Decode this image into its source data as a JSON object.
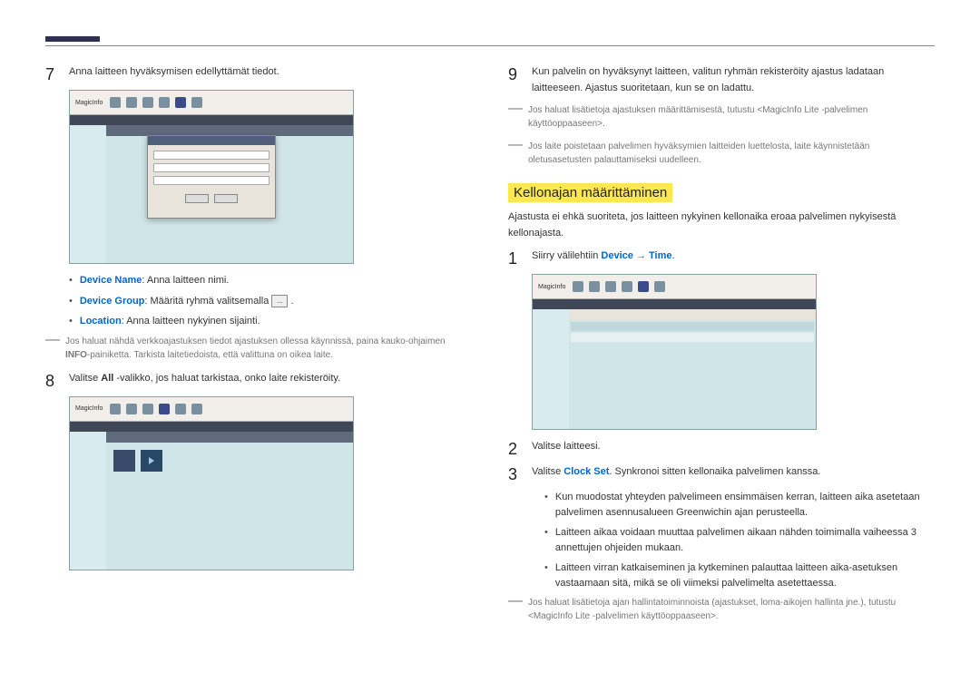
{
  "left": {
    "step7": {
      "num": "7",
      "text": "Anna laitteen hyväksymisen edellyttämät tiedot."
    },
    "ss1_logo": "MagicInfo",
    "bullets": {
      "deviceName_label": "Device Name",
      "deviceName_text": ": Anna laitteen nimi.",
      "deviceGroup_label": "Device Group",
      "deviceGroup_text": ": Määritä ryhmä valitsemalla",
      "deviceGroup_after": ".",
      "dots": "...",
      "location_label": "Location",
      "location_text": ": Anna laitteen nykyinen sijainti."
    },
    "note1": "Jos haluat nähdä verkkoajastuksen tiedot ajastuksen ollessa käynnissä, paina kauko-ohjaimen ",
    "note1_bold": "INFO",
    "note1_after": "-painiketta. Tarkista laitetiedoista, että valittuna on oikea laite.",
    "step8": {
      "num": "8",
      "text_before": "Valitse ",
      "all": "All",
      "text_after": " -valikko, jos haluat tarkistaa, onko laite rekisteröity."
    },
    "ss2_logo": "MagicInfo"
  },
  "right": {
    "step9": {
      "num": "9",
      "text": "Kun palvelin on hyväksynyt laitteen, valitun ryhmän rekisteröity ajastus ladataan laitteeseen. Ajastus suoritetaan, kun se on ladattu."
    },
    "noteA": "Jos haluat lisätietoja ajastuksen määrittämisestä, tutustu <MagicInfo Lite -palvelimen käyttöoppaaseen>.",
    "noteB": "Jos laite poistetaan palvelimen hyväksymien laitteiden luettelosta, laite käynnistetään oletusasetusten palauttamiseksi uudelleen.",
    "heading": "Kellonajan määrittäminen",
    "intro": "Ajastusta ei ehkä suoriteta, jos laitteen nykyinen kellonaika eroaa palvelimen nykyisestä kellonajasta.",
    "step1": {
      "num": "1",
      "text_before": "Siirry välilehtiin ",
      "device": "Device",
      "arrow": " → ",
      "time": "Time",
      "after": "."
    },
    "ss3_logo": "MagicInfo",
    "step2": {
      "num": "2",
      "text": "Valitse laitteesi."
    },
    "step3": {
      "num": "3",
      "text_before": "Valitse ",
      "clockset": "Clock Set",
      "text_after": ". Synkronoi sitten kellonaika palvelimen kanssa."
    },
    "subA": "Kun muodostat yhteyden palvelimeen ensimmäisen kerran, laitteen aika asetetaan palvelimen asennusalueen Greenwichin ajan perusteella.",
    "subB": "Laitteen aikaa voidaan muuttaa palvelimen aikaan nähden toimimalla vaiheessa 3 annettujen ohjeiden mukaan.",
    "subC": "Laitteen virran katkaiseminen ja kytkeminen palauttaa laitteen aika-asetuksen vastaamaan sitä, mikä se oli viimeksi palvelimelta asetettaessa.",
    "noteC": "Jos haluat lisätietoja ajan hallintatoiminnoista (ajastukset, loma-aikojen hallinta jne.), tutustu <MagicInfo Lite -palvelimen käyttöoppaaseen>."
  }
}
